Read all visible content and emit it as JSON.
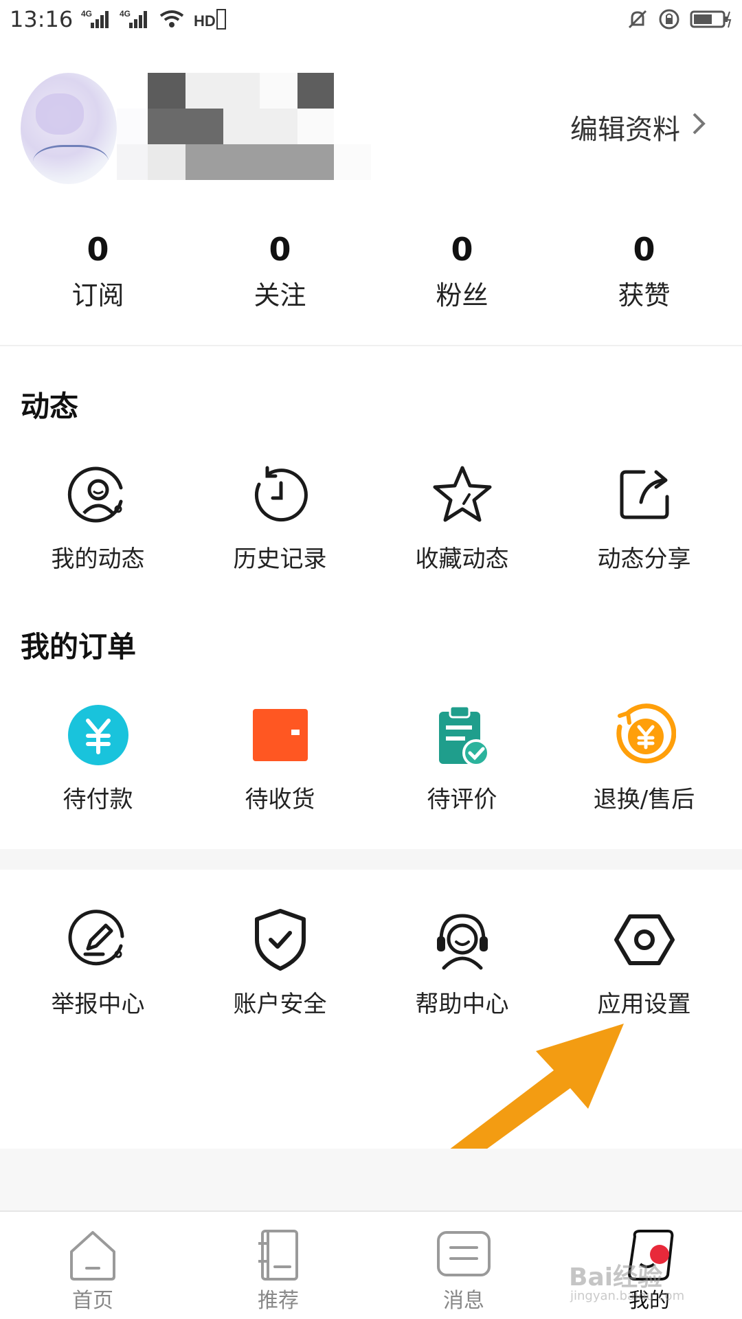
{
  "status_bar": {
    "time": "13:16",
    "sim1": "4G",
    "sim2": "4G",
    "hd": "HD"
  },
  "profile": {
    "edit_label": "编辑资料"
  },
  "stats": [
    {
      "value": "0",
      "label": "订阅"
    },
    {
      "value": "0",
      "label": "关注"
    },
    {
      "value": "0",
      "label": "粉丝"
    },
    {
      "value": "0",
      "label": "获赞"
    }
  ],
  "activity": {
    "title": "动态",
    "items": [
      {
        "label": "我的动态",
        "icon": "my-activity-icon"
      },
      {
        "label": "历史记录",
        "icon": "history-icon"
      },
      {
        "label": "收藏动态",
        "icon": "star-icon"
      },
      {
        "label": "动态分享",
        "icon": "share-icon"
      }
    ]
  },
  "orders": {
    "title": "我的订单",
    "items": [
      {
        "label": "待付款",
        "icon": "yen-circle-icon",
        "color": "#19c3dc"
      },
      {
        "label": "待收货",
        "icon": "wallet-icon",
        "color": "#ff5722"
      },
      {
        "label": "待评价",
        "icon": "clipboard-check-icon",
        "color": "#1f9e8c"
      },
      {
        "label": "退换/售后",
        "icon": "refund-icon",
        "color": "#ff9f0a"
      }
    ]
  },
  "services": {
    "items": [
      {
        "label": "举报中心",
        "icon": "report-icon"
      },
      {
        "label": "账户安全",
        "icon": "shield-icon"
      },
      {
        "label": "帮助中心",
        "icon": "headset-icon"
      },
      {
        "label": "应用设置",
        "icon": "settings-icon"
      }
    ]
  },
  "tab_bar": {
    "tabs": [
      {
        "label": "首页",
        "icon": "home-icon"
      },
      {
        "label": "推荐",
        "icon": "book-icon"
      },
      {
        "label": "消息",
        "icon": "message-icon"
      },
      {
        "label": "我的",
        "icon": "profile-icon",
        "active": true
      }
    ]
  },
  "watermark": {
    "text": "Bai经验",
    "sub": "jingyan.baidu.com"
  },
  "colors": {
    "accent_arrow": "#f39c12",
    "badge_red": "#e8293a"
  }
}
